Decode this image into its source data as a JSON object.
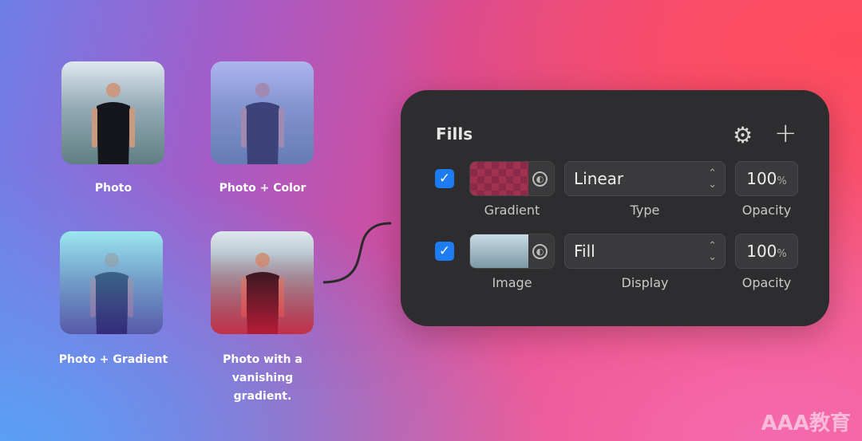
{
  "examples": [
    {
      "label": "Photo",
      "overlay": "none"
    },
    {
      "label": "Photo + Color",
      "overlay": "rgba(110,120,240,0.45)"
    },
    {
      "label": "Photo + Gradient",
      "overlay": "linear-gradient(180deg,rgba(100,230,240,.55),rgba(80,60,200,.55))"
    },
    {
      "label": "Photo with a vanishing gradient.",
      "overlay": "linear-gradient(180deg,rgba(230,60,110,0) 20%,rgba(220,30,60,.8) 100%)"
    }
  ],
  "panel": {
    "title": "Fills",
    "settings_icon": "gear-icon",
    "add_icon": "plus-icon",
    "fills": [
      {
        "enabled": true,
        "preview": "gradient",
        "preview_label": "Gradient",
        "dropdown_value": "Linear",
        "dropdown_label": "Type",
        "opacity": "100",
        "opacity_unit": "%",
        "opacity_label": "Opacity"
      },
      {
        "enabled": true,
        "preview": "image",
        "preview_label": "Image",
        "dropdown_value": "Fill",
        "dropdown_label": "Display",
        "opacity": "100",
        "opacity_unit": "%",
        "opacity_label": "Opacity"
      }
    ]
  },
  "watermark": "AAA教育",
  "colors": {
    "checkbox": "#1e7cf2",
    "panel": "#2d2d2f"
  }
}
